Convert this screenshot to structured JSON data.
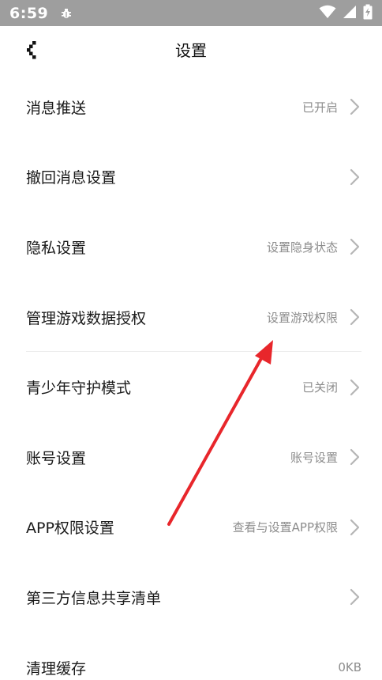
{
  "status_bar": {
    "time": "6:59",
    "icons": [
      "debug-icon",
      "wifi-icon",
      "signal-icon",
      "battery-charging-icon"
    ]
  },
  "header": {
    "title": "设置",
    "back_icon": "back-chevron-icon"
  },
  "settings": [
    {
      "label": "消息推送",
      "value": "已开启",
      "chevron": true
    },
    {
      "label": "撤回消息设置",
      "value": "",
      "chevron": true
    },
    {
      "label": "隐私设置",
      "value": "设置隐身状态",
      "chevron": true
    },
    {
      "label": "管理游戏数据授权",
      "value": "设置游戏权限",
      "chevron": true
    },
    {
      "label": "青少年守护模式",
      "value": "已关闭",
      "chevron": true
    },
    {
      "label": "账号设置",
      "value": "账号设置",
      "chevron": true
    },
    {
      "label": "APP权限设置",
      "value": "查看与设置APP权限",
      "chevron": true
    },
    {
      "label": "第三方信息共享清单",
      "value": "",
      "chevron": true
    },
    {
      "label": "清理缓存",
      "value": "0KB",
      "chevron": false
    }
  ],
  "colors": {
    "status_bar_bg": "#9e9e9e",
    "text_primary": "#1a1a1a",
    "text_secondary": "#8c8c8c",
    "chevron": "#b5b5b5",
    "annotation_arrow": "#e8262b"
  }
}
